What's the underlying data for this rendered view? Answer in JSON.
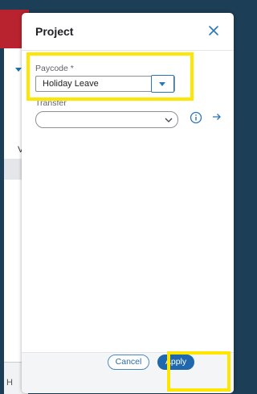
{
  "background": {
    "letter_mid": "V",
    "letter_bottom": "H"
  },
  "modal": {
    "title": "Project",
    "close_icon": "close-icon"
  },
  "paycode": {
    "label": "Paycode *",
    "value": "Holiday Leave",
    "dropdown_icon": "caret-down-icon"
  },
  "transfer": {
    "label": "Transfer",
    "value": "",
    "icons": [
      "chevron-down-icon",
      "info-icon",
      "arrow-right-icon"
    ]
  },
  "footer": {
    "cancel_label": "Cancel",
    "apply_label": "Apply"
  },
  "colors": {
    "accent": "#1f68ad",
    "highlight": "#ffe600",
    "brand_red": "#b8232f",
    "dark_bg": "#1c3e57"
  }
}
